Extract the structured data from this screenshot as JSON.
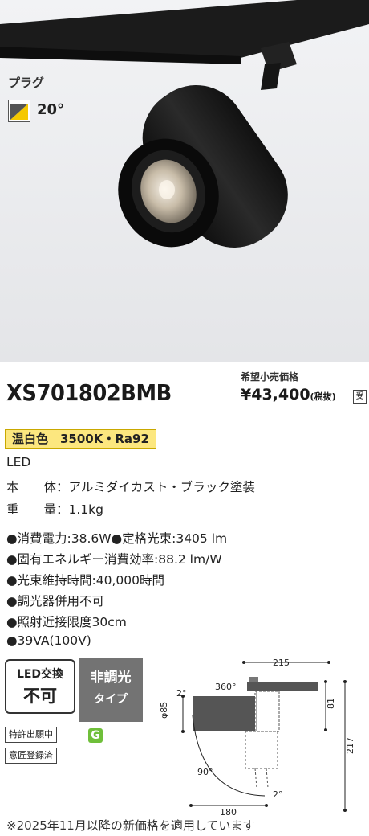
{
  "photo": {
    "plug_label": "プラグ",
    "beam_angle": "20°",
    "colors": {
      "body": "#1a1a1a",
      "track": "#202020",
      "background": "#e9eaec",
      "reflector": "#c9c0b0"
    }
  },
  "product": {
    "model": "XS701802BMB",
    "price_label": "希望小売価格",
    "price": "¥43,400",
    "price_tax": "(税抜)",
    "price_mark": "受",
    "spec_badge": "温白色　3500K・Ra92"
  },
  "specs": [
    "LED",
    "本　　体：アルミダイカスト・ブラック塗装",
    "重　　量：1.1kg",
    "●消費電力:38.6W●定格光束:3405 lm",
    "●固有エネルギー消費効率:88.2 lm/W",
    "●光束維持時間:40,000時間",
    "●調光器併用不可",
    "●照射近接限度30cm",
    "●39VA(100V)"
  ],
  "badges": {
    "led_exchange_line1": "LED交換",
    "led_exchange_line2": "不可",
    "non_dimming_line1": "非調光",
    "non_dimming_line2": "タイプ",
    "patent": "特許出願中",
    "design": "意匠登録済",
    "g_mark": "G"
  },
  "diagram": {
    "dim_width": "215",
    "dim_height_total": "217",
    "dim_height_track": "81",
    "dim_diameter": "φ85",
    "dim_depth": "180",
    "angle_rotate": "360°",
    "angle_tilt": "90°",
    "angle_top": "2°",
    "angle_bottom": "2°"
  },
  "footnote": "※2025年11月以降の新価格を適用しています"
}
